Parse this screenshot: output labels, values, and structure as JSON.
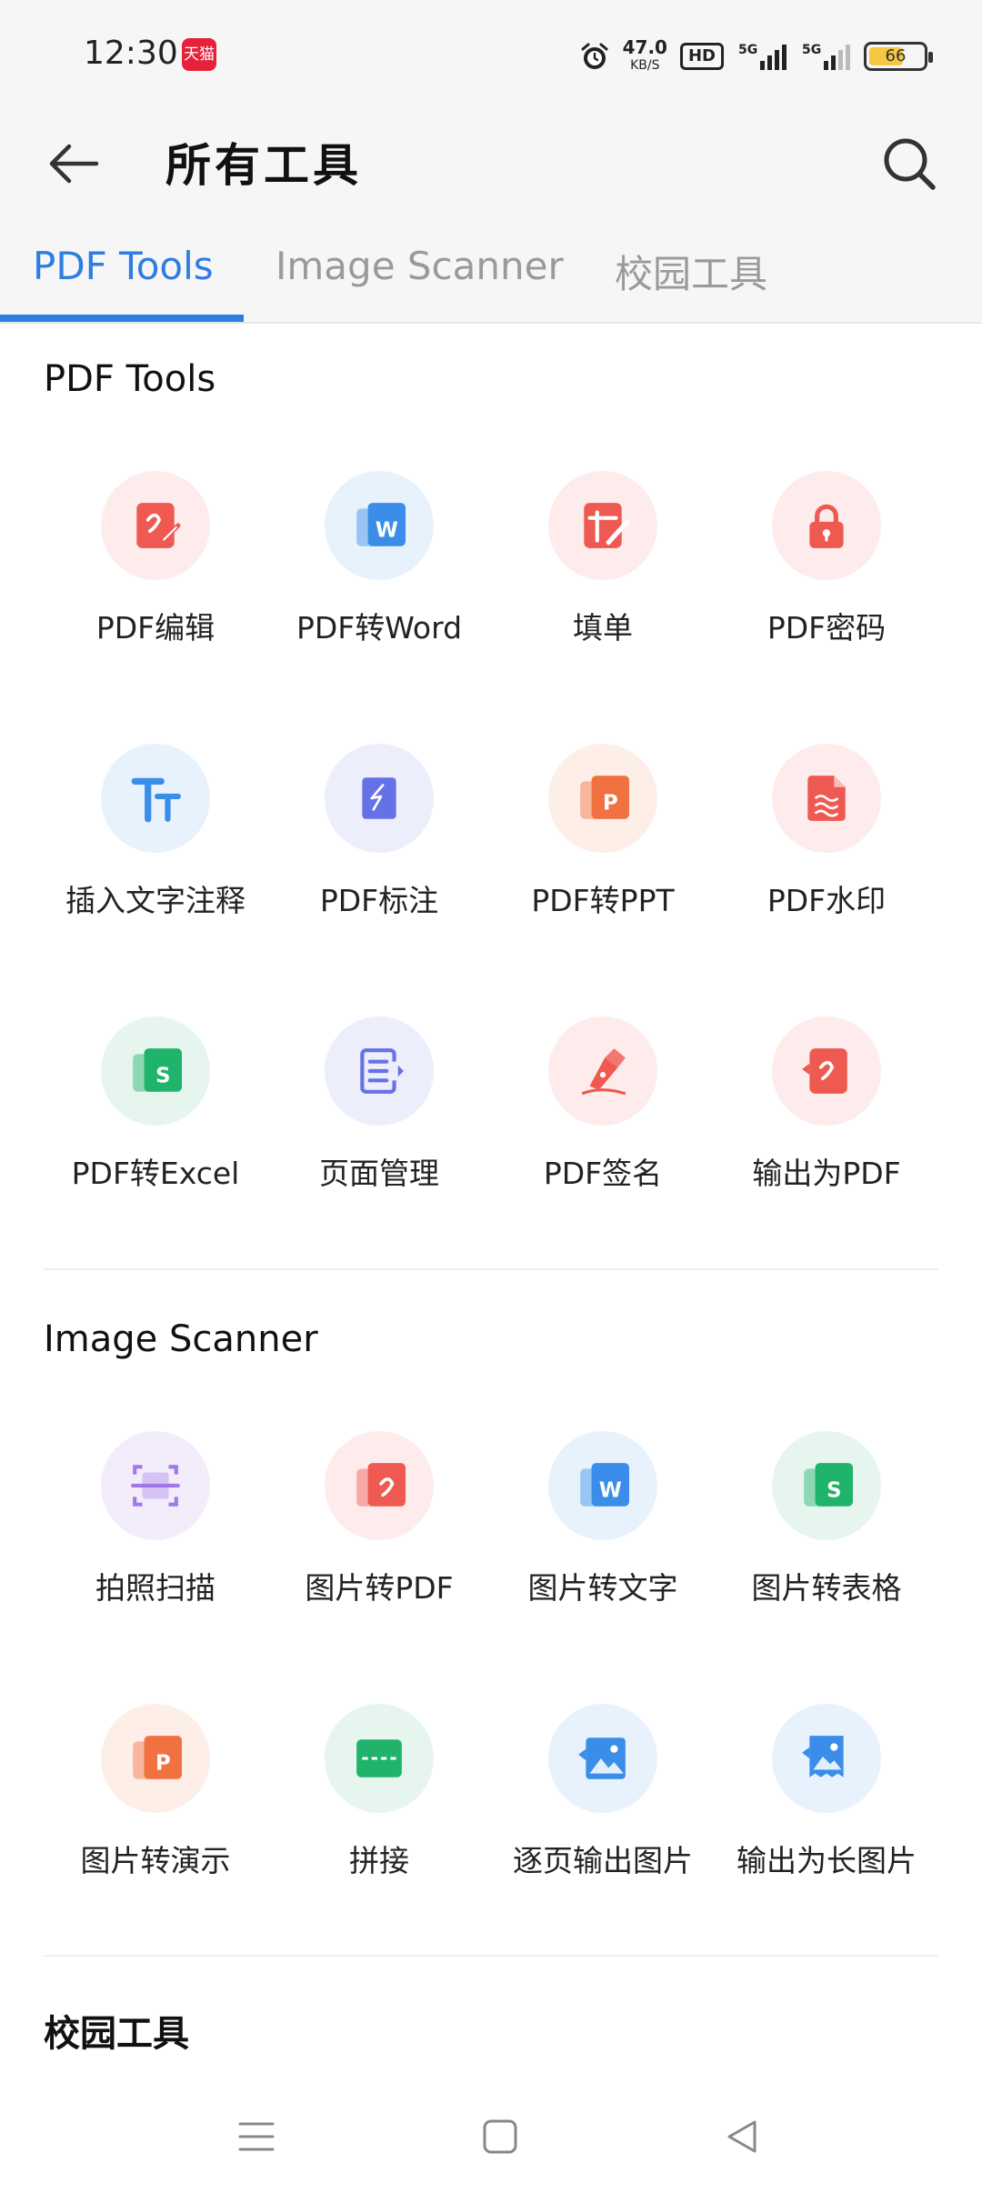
{
  "status_bar": {
    "time": "12:30",
    "tmall_label": "天猫",
    "net_speed_value": "47.0",
    "net_speed_unit": "KB/S",
    "hd_label": "HD",
    "signal_1_label": "5G",
    "signal_2_label": "5G",
    "battery_level": "66"
  },
  "header": {
    "title": "所有工具",
    "back_icon": "arrow-left-icon",
    "search_icon": "search-icon"
  },
  "tabs": [
    {
      "label": "PDF Tools",
      "active": true
    },
    {
      "label": "Image Scanner",
      "active": false
    },
    {
      "label": "校园工具",
      "active": false
    }
  ],
  "sections": [
    {
      "title": "PDF Tools",
      "tools": [
        {
          "label": "PDF编辑",
          "icon": "pdf-edit-icon",
          "bg": "#fdeceb",
          "color": "#ee5a52"
        },
        {
          "label": "PDF转Word",
          "icon": "pdf-to-word-icon",
          "bg": "#e8f2fd",
          "color": "#3a8ee9"
        },
        {
          "label": "填单",
          "icon": "fill-form-icon",
          "bg": "#fdeceb",
          "color": "#ee5a52"
        },
        {
          "label": "PDF密码",
          "icon": "lock-icon",
          "bg": "#fdeceb",
          "color": "#ee5a52"
        },
        {
          "label": "插入文字注释",
          "icon": "text-annotation-icon",
          "bg": "#e8f2fd",
          "color": "#3a8ee9"
        },
        {
          "label": "PDF标注",
          "icon": "pdf-markup-icon",
          "bg": "#eceefc",
          "color": "#6571e6"
        },
        {
          "label": "PDF转PPT",
          "icon": "pdf-to-ppt-icon",
          "bg": "#fdeee8",
          "color": "#f27140"
        },
        {
          "label": "PDF水印",
          "icon": "watermark-icon",
          "bg": "#fdeceb",
          "color": "#ee5a52"
        },
        {
          "label": "PDF转Excel",
          "icon": "pdf-to-excel-icon",
          "bg": "#e6f6ee",
          "color": "#1fb36b"
        },
        {
          "label": "页面管理",
          "icon": "page-manage-icon",
          "bg": "#eceefc",
          "color": "#6571e6"
        },
        {
          "label": "PDF签名",
          "icon": "signature-pen-icon",
          "bg": "#fdeceb",
          "color": "#ee5a52"
        },
        {
          "label": "输出为PDF",
          "icon": "export-pdf-icon",
          "bg": "#fdeceb",
          "color": "#ee5a52"
        }
      ]
    },
    {
      "title": "Image Scanner",
      "tools": [
        {
          "label": "拍照扫描",
          "icon": "scan-icon",
          "bg": "#f3ecfb",
          "color": "#a178e6"
        },
        {
          "label": "图片转PDF",
          "icon": "image-to-pdf-icon",
          "bg": "#fdeceb",
          "color": "#ee5a52"
        },
        {
          "label": "图片转文字",
          "icon": "image-to-text-icon",
          "bg": "#e8f2fd",
          "color": "#3a8ee9"
        },
        {
          "label": "图片转表格",
          "icon": "image-to-table-icon",
          "bg": "#e6f6ee",
          "color": "#1fb36b"
        },
        {
          "label": "图片转演示",
          "icon": "image-to-slides-icon",
          "bg": "#fdeee8",
          "color": "#f27140"
        },
        {
          "label": "拼接",
          "icon": "stitch-icon",
          "bg": "#e6f6ee",
          "color": "#1fb36b"
        },
        {
          "label": "逐页输出图片",
          "icon": "export-pages-image-icon",
          "bg": "#e8f2fd",
          "color": "#3a8ee9"
        },
        {
          "label": "输出为长图片",
          "icon": "export-long-image-icon",
          "bg": "#e8f2fd",
          "color": "#3a8ee9"
        }
      ]
    },
    {
      "title": "校园工具",
      "tools": []
    }
  ],
  "nav_bar": {
    "menu_icon": "menu-icon",
    "home_icon": "home-square-icon",
    "back_icon": "back-triangle-icon"
  }
}
